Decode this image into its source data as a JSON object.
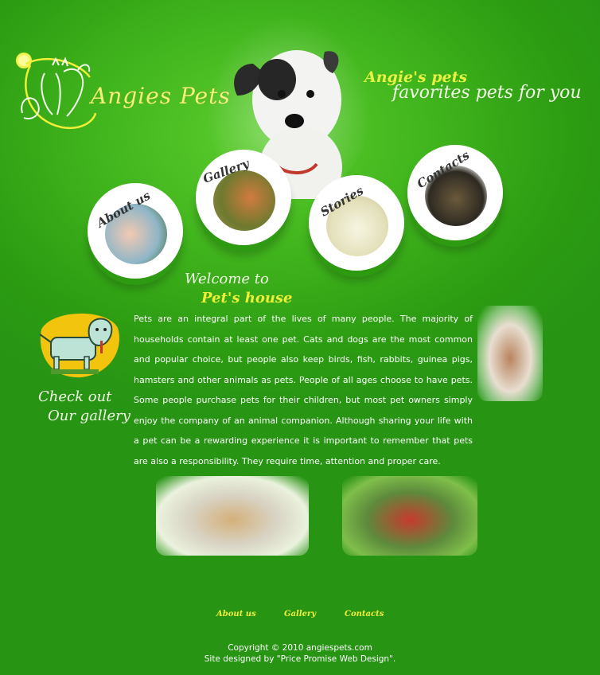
{
  "brand": {
    "name": "Angies Pets",
    "tagline_line1": "Angie's pets",
    "tagline_line2": "favorites pets for you"
  },
  "nav": {
    "items": [
      {
        "label": "About us"
      },
      {
        "label": "Gallery"
      },
      {
        "label": "Stories"
      },
      {
        "label": "Contacts"
      }
    ]
  },
  "welcome": {
    "line1": "Welcome to",
    "line2": "Pet's house",
    "body": "Pets are an integral part of the lives of many people. The majority of households contain at least one pet. Cats and dogs are the most common and popular choice, but people also keep birds, fish, rabbits, guinea pigs, hamsters and other animals as pets. People of all ages choose to have pets. Some people purchase pets for their children, but most pet owners simply enjoy the company of an animal companion. Although sharing your life with a pet can be a rewarding experience it is important to remember that pets are also a responsibility. They require time, attention and proper care."
  },
  "gallery_link": {
    "line1": "Check out",
    "line2": "Our gallery"
  },
  "footer": {
    "nav": [
      "About us",
      "Gallery",
      "Contacts"
    ],
    "copyright": "Copyright © 2010 angiespets.com",
    "credit": "Site designed by \"Price Promise Web Design\"."
  },
  "colors": {
    "background": "#34a818",
    "accent_yellow": "#f0ef37",
    "text": "#ffffff"
  }
}
